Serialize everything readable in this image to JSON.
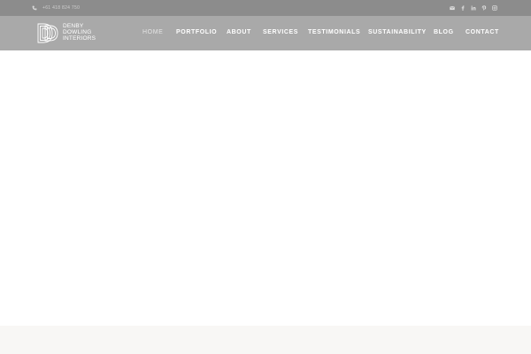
{
  "topbar": {
    "phone": "+61 418 824 750",
    "phone_icon": "phone-icon",
    "social_icons": [
      "email-icon",
      "facebook-icon",
      "linkedin-icon",
      "pinterest-icon",
      "instagram-icon"
    ]
  },
  "logo": {
    "line1": "DENBY",
    "line2": "DOWLING",
    "line3": "INTERIORS"
  },
  "nav": {
    "items": [
      {
        "label": "HOME"
      },
      {
        "label": "PORTFOLIO"
      },
      {
        "label": "ABOUT"
      },
      {
        "label": "SERVICES"
      },
      {
        "label": "TESTIMONIALS"
      },
      {
        "label": "SUSTAINABILITY"
      },
      {
        "label": "BLOG"
      },
      {
        "label": "CONTACT"
      }
    ],
    "active": "HOME"
  },
  "colors": {
    "topbar_bg": "#8c8c8c",
    "header_bg": "#a9a9a9",
    "nav_text": "#ffffff",
    "footer_band": "#f8f7f5"
  }
}
